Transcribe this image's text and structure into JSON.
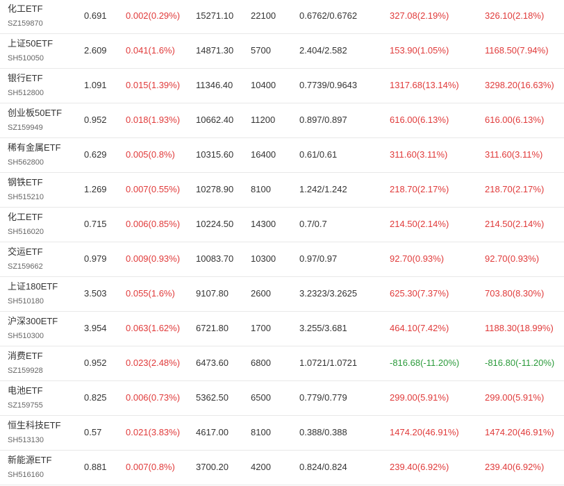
{
  "colors": {
    "up": "#e03a3a",
    "down": "#2a9a3a",
    "text": "#333333",
    "subtext": "#666666",
    "divider": "#e8e8e8"
  },
  "rows": [
    {
      "name": "化工ETF",
      "code": "SZ159870",
      "price": "0.691",
      "change": "0.002(0.29%)",
      "amount": "15271.10",
      "volume": "22100",
      "range": "0.6762/0.6762",
      "profit1": "327.08(2.19%)",
      "profit2": "326.10(2.18%)",
      "trend": "up"
    },
    {
      "name": "上证50ETF",
      "code": "SH510050",
      "price": "2.609",
      "change": "0.041(1.6%)",
      "amount": "14871.30",
      "volume": "5700",
      "range": "2.404/2.582",
      "profit1": "153.90(1.05%)",
      "profit2": "1168.50(7.94%)",
      "trend": "up"
    },
    {
      "name": "银行ETF",
      "code": "SH512800",
      "price": "1.091",
      "change": "0.015(1.39%)",
      "amount": "11346.40",
      "volume": "10400",
      "range": "0.7739/0.9643",
      "profit1": "1317.68(13.14%)",
      "profit2": "3298.20(16.63%)",
      "trend": "up"
    },
    {
      "name": "创业板50ETF",
      "code": "SZ159949",
      "price": "0.952",
      "change": "0.018(1.93%)",
      "amount": "10662.40",
      "volume": "11200",
      "range": "0.897/0.897",
      "profit1": "616.00(6.13%)",
      "profit2": "616.00(6.13%)",
      "trend": "up"
    },
    {
      "name": "稀有金属ETF",
      "code": "SH562800",
      "price": "0.629",
      "change": "0.005(0.8%)",
      "amount": "10315.60",
      "volume": "16400",
      "range": "0.61/0.61",
      "profit1": "311.60(3.11%)",
      "profit2": "311.60(3.11%)",
      "trend": "up"
    },
    {
      "name": "钢铁ETF",
      "code": "SH515210",
      "price": "1.269",
      "change": "0.007(0.55%)",
      "amount": "10278.90",
      "volume": "8100",
      "range": "1.242/1.242",
      "profit1": "218.70(2.17%)",
      "profit2": "218.70(2.17%)",
      "trend": "up"
    },
    {
      "name": "化工ETF",
      "code": "SH516020",
      "price": "0.715",
      "change": "0.006(0.85%)",
      "amount": "10224.50",
      "volume": "14300",
      "range": "0.7/0.7",
      "profit1": "214.50(2.14%)",
      "profit2": "214.50(2.14%)",
      "trend": "up"
    },
    {
      "name": "交运ETF",
      "code": "SZ159662",
      "price": "0.979",
      "change": "0.009(0.93%)",
      "amount": "10083.70",
      "volume": "10300",
      "range": "0.97/0.97",
      "profit1": "92.70(0.93%)",
      "profit2": "92.70(0.93%)",
      "trend": "up"
    },
    {
      "name": "上证180ETF",
      "code": "SH510180",
      "price": "3.503",
      "change": "0.055(1.6%)",
      "amount": "9107.80",
      "volume": "2600",
      "range": "3.2323/3.2625",
      "profit1": "625.30(7.37%)",
      "profit2": "703.80(8.30%)",
      "trend": "up"
    },
    {
      "name": "沪深300ETF",
      "code": "SH510300",
      "price": "3.954",
      "change": "0.063(1.62%)",
      "amount": "6721.80",
      "volume": "1700",
      "range": "3.255/3.681",
      "profit1": "464.10(7.42%)",
      "profit2": "1188.30(18.99%)",
      "trend": "up"
    },
    {
      "name": "消费ETF",
      "code": "SZ159928",
      "price": "0.952",
      "change": "0.023(2.48%)",
      "amount": "6473.60",
      "volume": "6800",
      "range": "1.0721/1.0721",
      "profit1": "-816.68(-11.20%)",
      "profit2": "-816.80(-11.20%)",
      "trend": "down"
    },
    {
      "name": "电池ETF",
      "code": "SZ159755",
      "price": "0.825",
      "change": "0.006(0.73%)",
      "amount": "5362.50",
      "volume": "6500",
      "range": "0.779/0.779",
      "profit1": "299.00(5.91%)",
      "profit2": "299.00(5.91%)",
      "trend": "up"
    },
    {
      "name": "恒生科技ETF",
      "code": "SH513130",
      "price": "0.57",
      "change": "0.021(3.83%)",
      "amount": "4617.00",
      "volume": "8100",
      "range": "0.388/0.388",
      "profit1": "1474.20(46.91%)",
      "profit2": "1474.20(46.91%)",
      "trend": "up"
    },
    {
      "name": "新能源ETF",
      "code": "SH516160",
      "price": "0.881",
      "change": "0.007(0.8%)",
      "amount": "3700.20",
      "volume": "4200",
      "range": "0.824/0.824",
      "profit1": "239.40(6.92%)",
      "profit2": "239.40(6.92%)",
      "trend": "up"
    }
  ]
}
